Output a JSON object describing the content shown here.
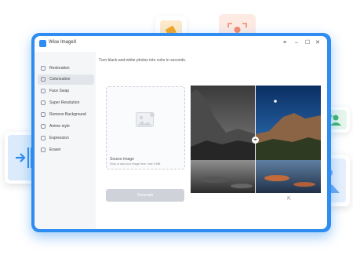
{
  "window": {
    "title": "Wise ImageX",
    "controls": {
      "menu": "≡",
      "minimize": "–",
      "maximize": "☐",
      "close": "✕"
    }
  },
  "sidebar": {
    "items": [
      {
        "label": "Restoration",
        "active": false
      },
      {
        "label": "Colorization",
        "active": true
      },
      {
        "label": "Face Swap",
        "active": false
      },
      {
        "label": "Super Resolution",
        "active": false
      },
      {
        "label": "Remove Background",
        "active": false
      },
      {
        "label": "Anime style",
        "active": false
      },
      {
        "label": "Expression",
        "active": false
      },
      {
        "label": "Eraser",
        "active": false
      }
    ]
  },
  "main": {
    "hint": "Turn black-and-white photos into color in seconds.",
    "dropzone": {
      "title": "Source image",
      "subtitle": "Drop or add your image here, max 5 MB.",
      "icon": "image-placeholder-icon"
    },
    "compare_knob": "◂▸",
    "generate_label": "Generate",
    "export_icon": "export-icon"
  },
  "colors": {
    "accent": "#2f8cf0",
    "sidebar_bg": "#f5f6f8",
    "active_item": "#e2e5ea",
    "generate_disabled": "#cfd3d9"
  },
  "floating_cards": [
    {
      "icon": "paint-bucket-icon",
      "color": "#f5a623"
    },
    {
      "icon": "face-scan-icon",
      "color": "#f08a6a"
    },
    {
      "icon": "split-compare-icon",
      "color": "#2f8cf0"
    },
    {
      "icon": "person-sparkle-icon",
      "color": "#3cb56a"
    },
    {
      "icon": "landscape-image-icon",
      "color": "#2f8cf0"
    }
  ]
}
